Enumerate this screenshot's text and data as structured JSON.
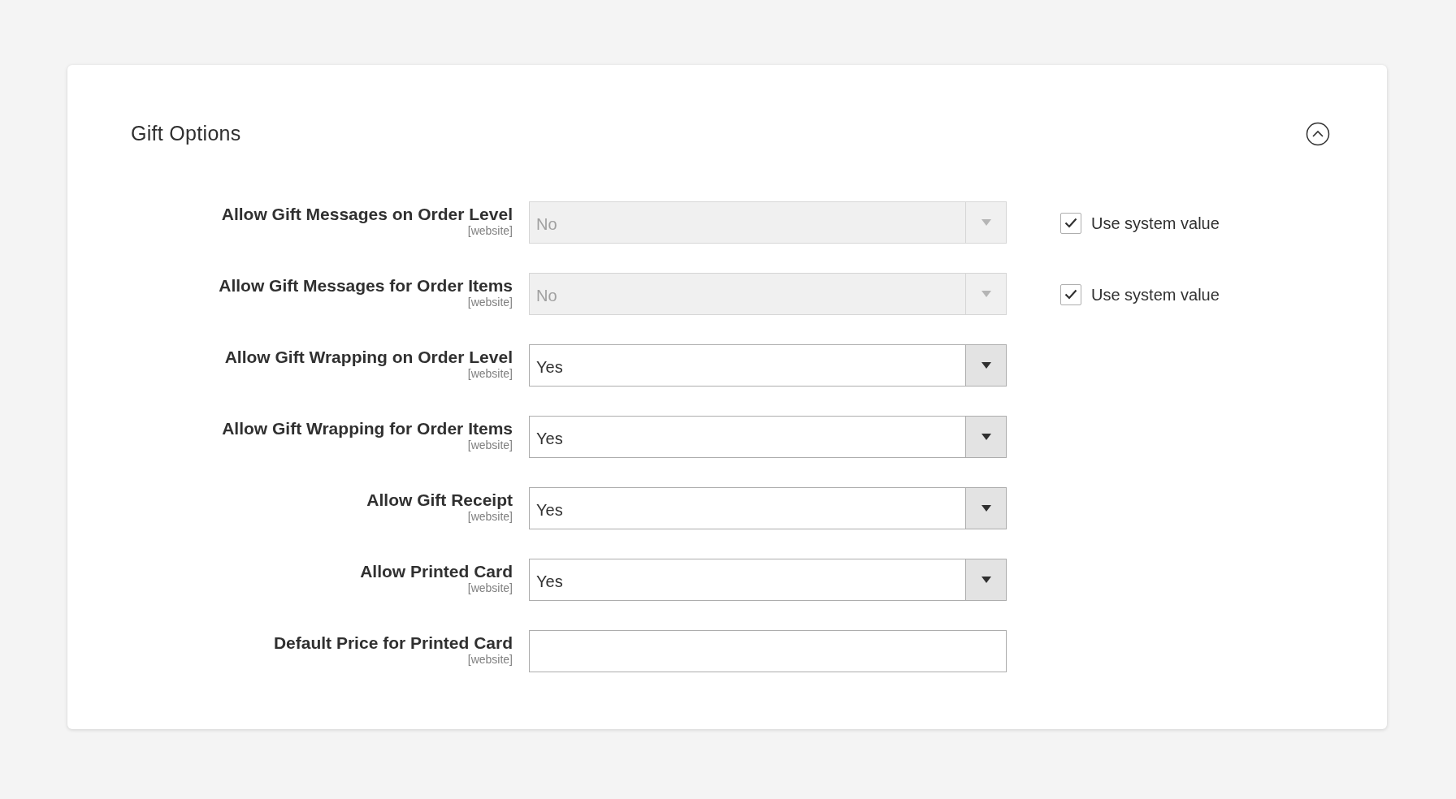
{
  "section": {
    "title": "Gift Options",
    "expanded": true
  },
  "fields": [
    {
      "label": "Allow Gift Messages on Order Level",
      "scope": "[website]",
      "kind": "select",
      "value": "No",
      "disabled": true,
      "use_system_value": {
        "label": "Use system value",
        "checked": true
      }
    },
    {
      "label": "Allow Gift Messages for Order Items",
      "scope": "[website]",
      "kind": "select",
      "value": "No",
      "disabled": true,
      "use_system_value": {
        "label": "Use system value",
        "checked": true
      }
    },
    {
      "label": "Allow Gift Wrapping on Order Level",
      "scope": "[website]",
      "kind": "select",
      "value": "Yes",
      "disabled": false
    },
    {
      "label": "Allow Gift Wrapping for Order Items",
      "scope": "[website]",
      "kind": "select",
      "value": "Yes",
      "disabled": false
    },
    {
      "label": "Allow Gift Receipt",
      "scope": "[website]",
      "kind": "select",
      "value": "Yes",
      "disabled": false
    },
    {
      "label": "Allow Printed Card",
      "scope": "[website]",
      "kind": "select",
      "value": "Yes",
      "disabled": false
    },
    {
      "label": "Default Price for Printed Card",
      "scope": "[website]",
      "kind": "text"
    }
  ]
}
